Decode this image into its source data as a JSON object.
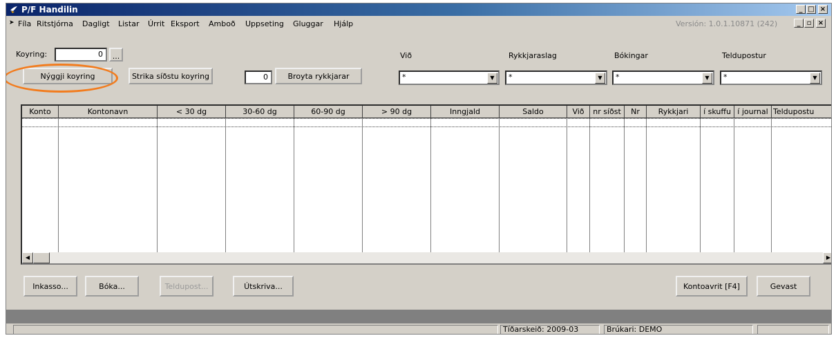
{
  "window": {
    "title": "P/F Handilin"
  },
  "menu": [
    "Fíla",
    "Ritstjórna",
    "Dagligt",
    "Listar",
    "Úrrit",
    "Eksport",
    "Amboð",
    "Uppseting",
    "Gluggar",
    "Hjálp"
  ],
  "version": "Versión: 1.0.1.10871 (242)",
  "koyring": {
    "label": "Koyring:",
    "value": "0",
    "browse": "..."
  },
  "buttons": {
    "new_run": "Nýggji koyring",
    "delete_last_run": "Strika síðstu koyring",
    "reminder_count": "0",
    "change_reminders": "Broyta rykkjarar"
  },
  "filters": [
    {
      "label": "Við",
      "value": "*"
    },
    {
      "label": "Rykkjaraslag",
      "value": "*"
    },
    {
      "label": "Bókingar",
      "value": "*"
    },
    {
      "label": "Teldupostur",
      "value": "*"
    }
  ],
  "table": {
    "columns": [
      "Konto",
      "Kontonavn",
      "< 30 dg",
      "30-60 dg",
      "60-90 dg",
      "> 90 dg",
      "Inngjald",
      "Saldo",
      "Við",
      "nr síðst",
      "Nr",
      "Rykkjari",
      "í skuffu",
      "í journal",
      "Teldupostu"
    ],
    "rows": []
  },
  "bottom_buttons": {
    "inkasso": "Inkasso...",
    "boka": "Bóka...",
    "teldupost": "Teldupost...",
    "utskriva": "Útskriva...",
    "kontoavrit": "Kontoavrit [F4]",
    "gevast": "Gevast"
  },
  "status": {
    "period": "Tíðarskeið: 2009-03",
    "user": "Brúkari: DEMO"
  },
  "colors": {
    "highlight": "#f27c1e",
    "titlebar": "#0a246a"
  }
}
